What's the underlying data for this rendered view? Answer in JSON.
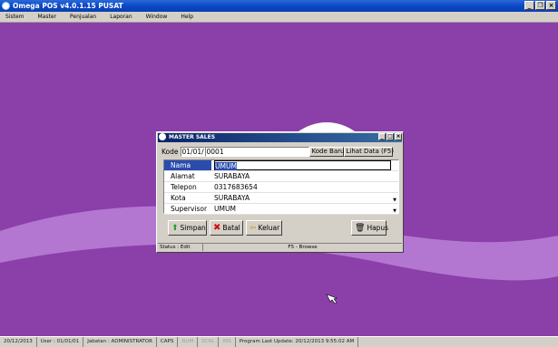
{
  "window": {
    "title": "Omega POS v4.0.1.15 PUSAT"
  },
  "menu": [
    "Sistem",
    "Master",
    "Penjualan",
    "Laporan",
    "Window",
    "Help"
  ],
  "dialog": {
    "title": "MASTER SALES",
    "kode_label": "Kode",
    "kode_prefix": "01/01/",
    "kode_value": "0001",
    "kode_baru_label": "Kode Baru",
    "lihat_data_label": "Lihat Data (F5)",
    "fields": [
      {
        "label": "Nama",
        "value": "UMUM"
      },
      {
        "label": "Alamat",
        "value": "SURABAYA"
      },
      {
        "label": "Telepon",
        "value": "0317683654"
      },
      {
        "label": "Kota",
        "value": "SURABAYA"
      },
      {
        "label": "Supervisor",
        "value": "UMUM"
      }
    ],
    "buttons": {
      "simpan": "Simpan",
      "batal": "Batal",
      "keluar": "Keluar",
      "hapus": "Hapus"
    },
    "status": {
      "left": "Status : Edit",
      "right": "F5 - Browse"
    }
  },
  "statusbar": {
    "date": "20/12/2013",
    "user": "User : 01/01/01",
    "jabatan": "Jabatan : ADMINISTRATOR",
    "caps": "CAPS",
    "num": "NUM",
    "scrl": "SCRL",
    "ins": "INS",
    "update": "Program Last Update: 20/12/2013 9:55:02 AM"
  },
  "colors": {
    "background": "#8b3fa8",
    "wave": "#b97ad6",
    "titlebar": "#0a48c8"
  }
}
